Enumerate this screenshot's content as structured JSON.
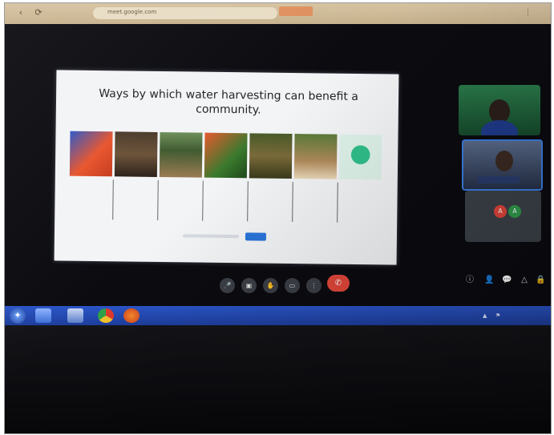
{
  "browser": {
    "nav_back": "‹",
    "nav_reload": "⟳",
    "url": "meet.google.com",
    "tab_label": "",
    "menu_dots": "⋮"
  },
  "meeting": {
    "title": "",
    "code": ""
  },
  "slide": {
    "title": "Ways by which water harvesting can benefit a community.",
    "captions": [
      "",
      "",
      "",
      "",
      "",
      "",
      ""
    ]
  },
  "participants": {
    "speaker_name": "",
    "avatar_1": "A",
    "avatar_2": "A",
    "others_label": ""
  },
  "controls": {
    "mic": "🎤",
    "camera": "▣",
    "hand": "✋",
    "present": "▭",
    "more": "⋮",
    "end_call": "✆"
  },
  "right_icons": {
    "info": "ⓘ",
    "people": "👤",
    "chat": "💬",
    "activities": "△",
    "lock": "🔒"
  },
  "taskbar": {
    "clock_time": "",
    "clock_date": "",
    "tray_arrow": "▲",
    "tray_flag": "⚑"
  },
  "colors": {
    "accent": "#2a74d8",
    "end_call": "#e2473a",
    "avatar_red": "#e0443a",
    "avatar_green": "#2e9a4a"
  }
}
